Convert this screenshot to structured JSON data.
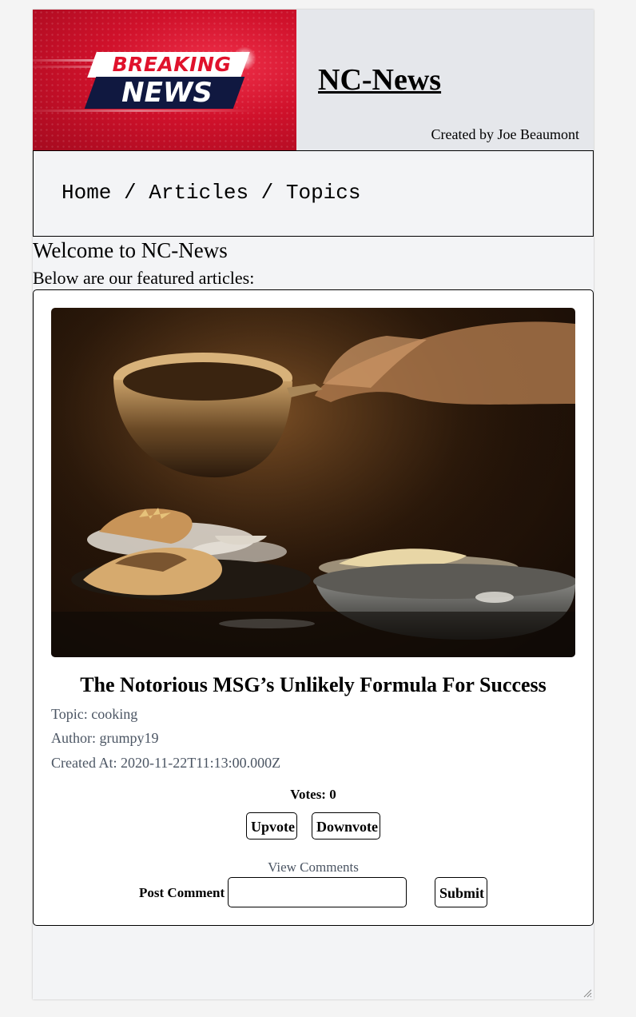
{
  "header": {
    "logo_line1": "BREAKING",
    "logo_line2": "NEWS",
    "site_title": "NC-News",
    "credit": "Created by Joe Beaumont"
  },
  "nav": {
    "home": "Home",
    "articles": "Articles",
    "topics": "Topics",
    "separator": " / "
  },
  "intro": {
    "welcome": "Welcome to NC-News",
    "subtitle": "Below are our featured articles:"
  },
  "article": {
    "title": "The Notorious MSG’s Unlikely Formula For Success",
    "topic": "Topic: cooking",
    "author": "Author: grumpy19",
    "created_at": "Created At: 2020-11-22T11:13:00.000Z",
    "votes": "Votes: 0",
    "upvote_label": "Upvote",
    "downvote_label": "Downvote",
    "view_comments": "View Comments",
    "post_comment_label": "Post Comment",
    "comment_value": "",
    "submit_label": "Submit"
  },
  "colors": {
    "page_bg": "#f3f4f6",
    "header_bg": "#e5e7eb",
    "logo_red": "#d0112b",
    "logo_navy": "#101840",
    "meta_text": "#4b5563"
  }
}
